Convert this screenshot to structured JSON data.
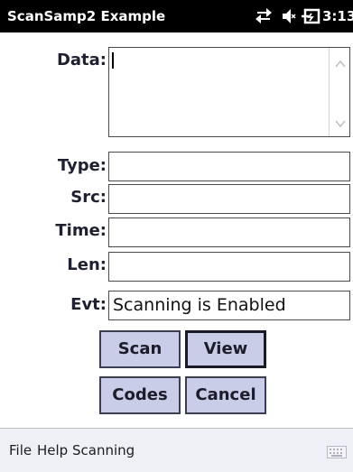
{
  "titlebar": {
    "title": "ScanSamp2 Example",
    "clock": "3:13",
    "icons": [
      "connectivity-icon",
      "speaker-muted-icon",
      "battery-charging-icon"
    ]
  },
  "form": {
    "data_label": "Data:",
    "data_value": "",
    "type_label": "Type:",
    "type_value": "",
    "src_label": "Src:",
    "src_value": "",
    "time_label": "Time:",
    "time_value": "",
    "len_label": "Len:",
    "len_value": "",
    "evt_label": "Evt:",
    "evt_value": "Scanning is Enabled"
  },
  "buttons": {
    "scan": "Scan",
    "view": "View",
    "codes": "Codes",
    "cancel": "Cancel"
  },
  "menubar": {
    "items": [
      "File",
      "Help",
      "Scanning"
    ],
    "keyboard_icon": "keyboard-icon"
  },
  "colors": {
    "titlebar_bg": "#000000",
    "button_bg": "#c9cde8",
    "menubar_bg": "#eef0f6"
  }
}
